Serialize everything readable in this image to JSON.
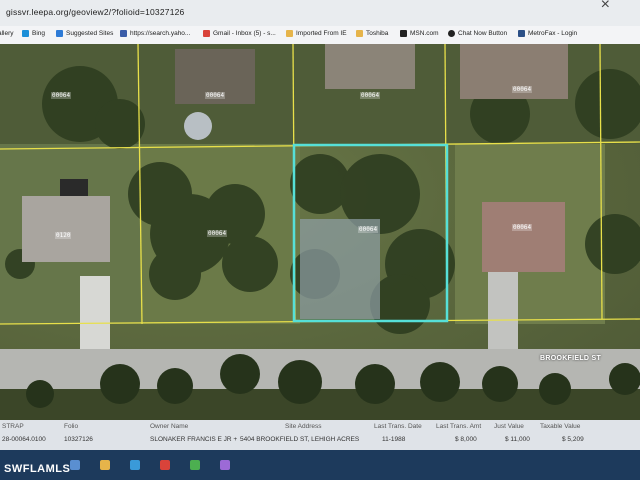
{
  "browser": {
    "url": "gissvr.leepa.org/geoview2/?folioid=10327126",
    "bookmarks": [
      {
        "label": "allery",
        "icon": "page-icon"
      },
      {
        "label": "Bing",
        "icon": "bing-icon"
      },
      {
        "label": "Suggested Sites",
        "icon": "suggested-sites-icon"
      },
      {
        "label": "https://search.yaho...",
        "icon": "yahoo-icon"
      },
      {
        "label": "Gmail - Inbox (5) - s...",
        "icon": "gmail-icon"
      },
      {
        "label": "Imported From IE",
        "icon": "folder-icon"
      },
      {
        "label": "Toshiba",
        "icon": "folder-icon"
      },
      {
        "label": "MSN.com",
        "icon": "msn-icon"
      },
      {
        "label": "Chat Now Button",
        "icon": "chat-icon"
      },
      {
        "label": "MetroFax - Login",
        "icon": "metrofax-icon"
      }
    ]
  },
  "map": {
    "street_name": "BROOKFIELD ST",
    "lot_labels": [
      "00064",
      "00064",
      "00064",
      "00064",
      "0120",
      "00064",
      "00064",
      "00064"
    ],
    "highlight_color": "#56e0d8",
    "parcel_line_color": "#e8e04a"
  },
  "info_table": {
    "headers": [
      "STRAP",
      "Folio",
      "Owner Name",
      "Site Address",
      "Last Trans. Date",
      "Last Trans. Amt",
      "Just Value",
      "Taxable Value"
    ],
    "values": [
      "28-00064.0100",
      "10327126",
      "SLONAKER FRANCIS E JR +",
      "5404 BROOKFIELD ST, LEHIGH ACRES",
      "11-1988",
      "$ 8,000",
      "$ 11,000",
      "$ 5,209"
    ]
  },
  "watermark": "SWFLAMLS"
}
